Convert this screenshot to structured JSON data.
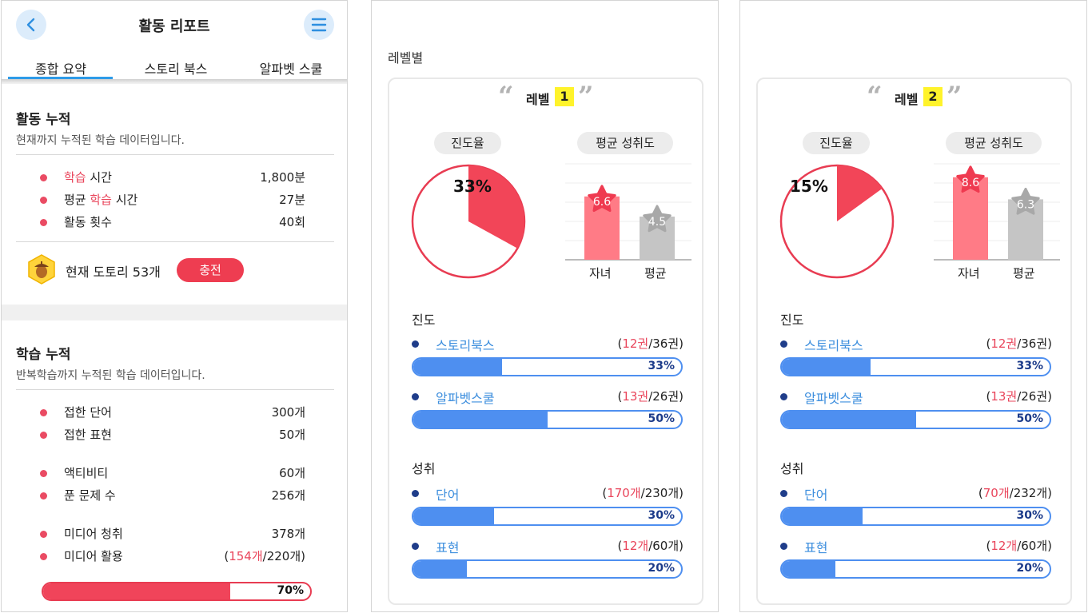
{
  "summary": {
    "title": "활동 리포트",
    "tabs": [
      "종합 요약",
      "스토리 북스",
      "알파벳 스쿨"
    ],
    "activity": {
      "title": "활동 누적",
      "desc": "현재까지 누적된 학습 데이터입니다.",
      "rows": [
        {
          "pre": "",
          "hl": "학습",
          "post": " 시간",
          "value": "1,800분"
        },
        {
          "pre": "평균 ",
          "hl": "학습",
          "post": " 시간",
          "value": "27분"
        },
        {
          "pre": "활동 횟수",
          "hl": "",
          "post": "",
          "value": "40회"
        }
      ],
      "acorn_text": "현재 도토리 53개",
      "charge_label": "충전"
    },
    "learning": {
      "title": "학습 누적",
      "desc": "반복학습까지 누적된 학습 데이터입니다.",
      "rows": [
        {
          "label": "접한 단어",
          "value": "300개"
        },
        {
          "label": "접한 표현",
          "value": "50개"
        },
        {
          "label": "액티비티",
          "value": "60개"
        },
        {
          "label": "푼 문제 수",
          "value": "256개"
        },
        {
          "label": "미디어 청취",
          "value": "378개"
        },
        {
          "label": "미디어 활용",
          "value_open": "(",
          "value_hl": "154개",
          "value_rest": "/220개)"
        }
      ],
      "bar_percent": 70,
      "bar_label": "70%"
    },
    "colors": {
      "accent_pink": "#e9455b",
      "tab_blue": "#2e9be8"
    }
  },
  "section_title": "레벨별",
  "levels": [
    {
      "word": "레벨",
      "num": "1",
      "progress_pill": "진도율",
      "achieve_pill": "평균 성취도",
      "pie_percent": 33,
      "pie_label": "33%",
      "child_score": 6.6,
      "child_label": "6.6",
      "avg_score": 4.5,
      "avg_label": "4.5",
      "x_child": "자녀",
      "x_avg": "평균",
      "progress_title": "진도",
      "achieve_title": "성취",
      "items": [
        {
          "label": "스토리북스",
          "open": "(",
          "hl": "12권",
          "rest": "/36권)",
          "percent": 33,
          "pct": "33%"
        },
        {
          "label": "알파벳스쿨",
          "open": "(",
          "hl": "13권",
          "rest": "/26권)",
          "percent": 50,
          "pct": "50%"
        },
        {
          "label": "단어",
          "open": "(",
          "hl": "170개",
          "rest": "/230개)",
          "percent": 30,
          "pct": "30%"
        },
        {
          "label": "표현",
          "open": "(",
          "hl": "12개",
          "rest": "/60개)",
          "percent": 20,
          "pct": "20%"
        }
      ]
    },
    {
      "word": "레벨",
      "num": "2",
      "progress_pill": "진도율",
      "achieve_pill": "평균 성취도",
      "pie_percent": 15,
      "pie_label": "15%",
      "child_score": 8.6,
      "child_label": "8.6",
      "avg_score": 6.3,
      "avg_label": "6.3",
      "x_child": "자녀",
      "x_avg": "평균",
      "progress_title": "진도",
      "achieve_title": "성취",
      "items": [
        {
          "label": "스토리북스",
          "open": "(",
          "hl": "12권",
          "rest": "/36권)",
          "percent": 33,
          "pct": "33%"
        },
        {
          "label": "알파벳스쿨",
          "open": "(",
          "hl": "13권",
          "rest": "/26권)",
          "percent": 50,
          "pct": "50%"
        },
        {
          "label": "단어",
          "open": "(",
          "hl": "70개",
          "rest": "/232개)",
          "percent": 30,
          "pct": "30%"
        },
        {
          "label": "표현",
          "open": "(",
          "hl": "12개",
          "rest": "/60개)",
          "percent": 20,
          "pct": "20%"
        }
      ]
    }
  ]
}
